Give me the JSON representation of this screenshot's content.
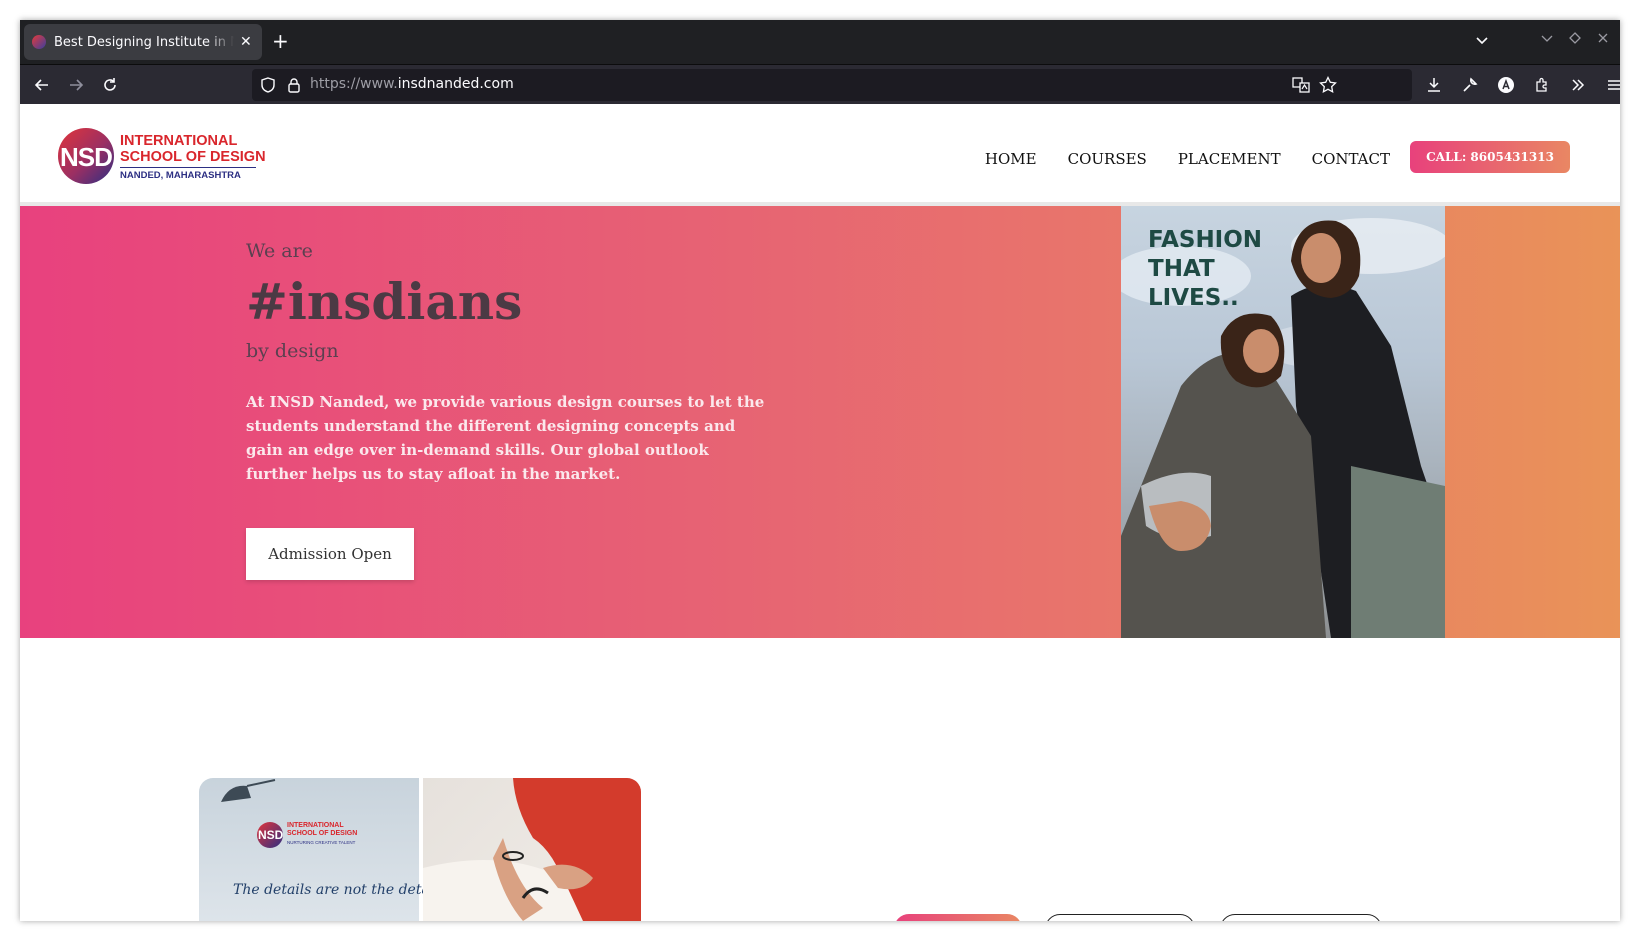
{
  "browser": {
    "tab_title": "Best Designing Institute in Nanded",
    "url_protocol": "https://www.",
    "url_domain": "insdnanded.com"
  },
  "site": {
    "logo": {
      "mark": "NSD",
      "line1": "INTERNATIONAL",
      "line2": "SCHOOL OF DESIGN",
      "line3": "NANDED, MAHARASHTRA"
    },
    "nav": {
      "items": [
        {
          "label": "HOME"
        },
        {
          "label": "COURSES"
        },
        {
          "label": "PLACEMENT"
        },
        {
          "label": "CONTACT"
        }
      ],
      "call_label": "CALL: 8605431313"
    },
    "hero": {
      "eyebrow": "We are",
      "title": "#insdians",
      "subtitle": "by design",
      "description": "At INSD Nanded, we provide various design courses to let the students understand the different designing concepts and gain an edge over in-demand skills. Our global outlook further helps us to stay afloat in the market.",
      "cta_label": "Admission Open",
      "photo_caption": "FASHION THAT LIVES.."
    },
    "gallery": {
      "logo_mark": "NSD",
      "logo_line1": "INTERNATIONAL",
      "logo_line2": "SCHOOL OF DESIGN",
      "logo_tagline": "NURTURING CREATIVE TALENT",
      "quote": "The details are not the details."
    }
  },
  "colors": {
    "hero_gradient_start": "#e8417e",
    "hero_gradient_end": "#e99358",
    "brand_red": "#d9262c",
    "brand_blue": "#2c2f83"
  }
}
